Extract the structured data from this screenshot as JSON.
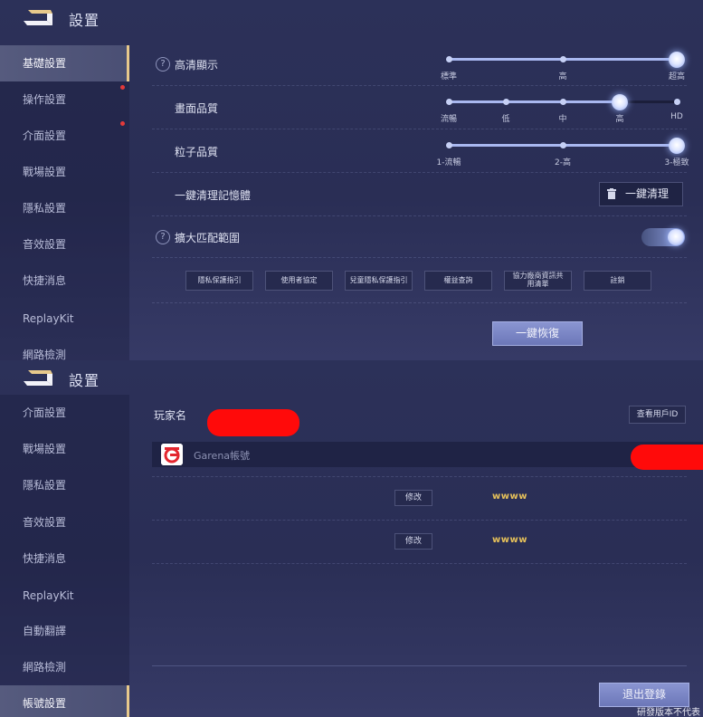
{
  "top": {
    "header": {
      "title": "設置",
      "back_icon": "back-arrow-icon"
    },
    "sidebar": [
      {
        "label": "基礎設置",
        "active": true,
        "dot": false
      },
      {
        "label": "操作設置",
        "active": false,
        "dot": true
      },
      {
        "label": "介面設置",
        "active": false,
        "dot": true
      },
      {
        "label": "戰場設置",
        "active": false,
        "dot": false
      },
      {
        "label": "隱私設置",
        "active": false,
        "dot": false
      },
      {
        "label": "音效設置",
        "active": false,
        "dot": false
      },
      {
        "label": "快捷消息",
        "active": false,
        "dot": false
      },
      {
        "label": "ReplayKit",
        "active": false,
        "dot": false
      },
      {
        "label": "網路檢測",
        "active": false,
        "dot": false
      }
    ],
    "settings": {
      "hd_display": {
        "label": "高清顯示",
        "help": "?",
        "ticks": [
          "標準",
          "高",
          "超高"
        ],
        "selected_index": 2
      },
      "graphics_quality": {
        "label": "畫面品質",
        "ticks": [
          "流暢",
          "低",
          "中",
          "高",
          "HD"
        ],
        "selected_index": 3
      },
      "particle_quality": {
        "label": "粒子品質",
        "ticks": [
          "1-流暢",
          "2-高",
          "3-極致"
        ],
        "selected_index": 2
      },
      "clear_memory": {
        "label": "一鍵清理記憶體",
        "button": "一鍵清理"
      },
      "expand_match": {
        "label": "擴大匹配範圍",
        "help": "?",
        "enabled": true
      }
    },
    "links": [
      "隱私保護指引",
      "使用者協定",
      "兒童隱私保護指引",
      "權益查詢",
      "協力廠商資訊共用清單",
      "註銷"
    ],
    "restore_button": "一鍵恢復"
  },
  "bottom": {
    "header": {
      "title": "設置",
      "back_icon": "back-arrow-icon"
    },
    "sidebar": [
      {
        "label": "介面設置",
        "active": false
      },
      {
        "label": "戰場設置",
        "active": false
      },
      {
        "label": "隱私設置",
        "active": false
      },
      {
        "label": "音效設置",
        "active": false
      },
      {
        "label": "快捷消息",
        "active": false
      },
      {
        "label": "ReplayKit",
        "active": false
      },
      {
        "label": "自動翻譯",
        "active": false
      },
      {
        "label": "網路檢測",
        "active": false
      },
      {
        "label": "帳號設置",
        "active": true
      }
    ],
    "account": {
      "player_label": "玩家名",
      "view_id_button": "查看用戶ID",
      "garena_label": "Garena帳號",
      "rows": [
        {
          "edit_button": "修改",
          "value": "wwww"
        },
        {
          "edit_button": "修改",
          "value": "wwww"
        }
      ],
      "logout_button": "退出登錄",
      "watermark": "研發版本不代表"
    }
  },
  "colors": {
    "accent_gold": "#e7c98b",
    "redaction": "#ff0a0a",
    "value_yellow": "#e6c15a",
    "notify_red": "#e43a3a"
  }
}
